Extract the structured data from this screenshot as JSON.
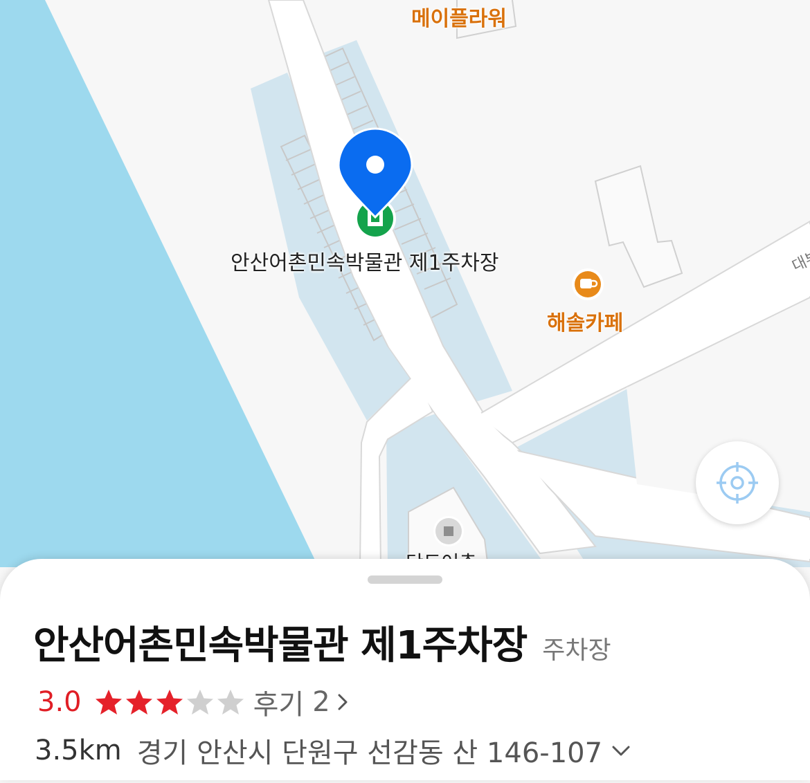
{
  "map": {
    "labels": {
      "top_poi": "메이플라워",
      "cafe_poi": "해솔카페",
      "parking_poi": "안산어촌민속박물관 제1주차장",
      "road_partial": "대부",
      "bottom_poi_partial": "단도어촌"
    },
    "icons": {
      "selected_marker": "location-pin-icon",
      "parking_marker": "parking-icon",
      "cafe_marker": "cafe-cup-icon",
      "bottom_marker": "building-icon",
      "locate_button": "crosshair-icon"
    },
    "colors": {
      "water": "#9dd9ee",
      "land": "#f7f7f7",
      "lot_area": "#d2e5ef",
      "road": "#ffffff",
      "marker_blue": "#0a6cf0",
      "parking_green": "#14a34c",
      "poi_orange": "#d9710b"
    }
  },
  "place": {
    "name": "안산어촌민속박물관 제1주차장",
    "category": "주차장",
    "rating": "3.0",
    "rating_value": 3.0,
    "stars_max": 5,
    "review_label": "후기",
    "review_count": "2",
    "distance": "3.5km",
    "address": "경기 안산시 단원구 선감동 산 146-107"
  },
  "colors": {
    "rating_red": "#e01e25",
    "star_filled": "#e5212a",
    "star_empty": "#cfcfcf"
  }
}
